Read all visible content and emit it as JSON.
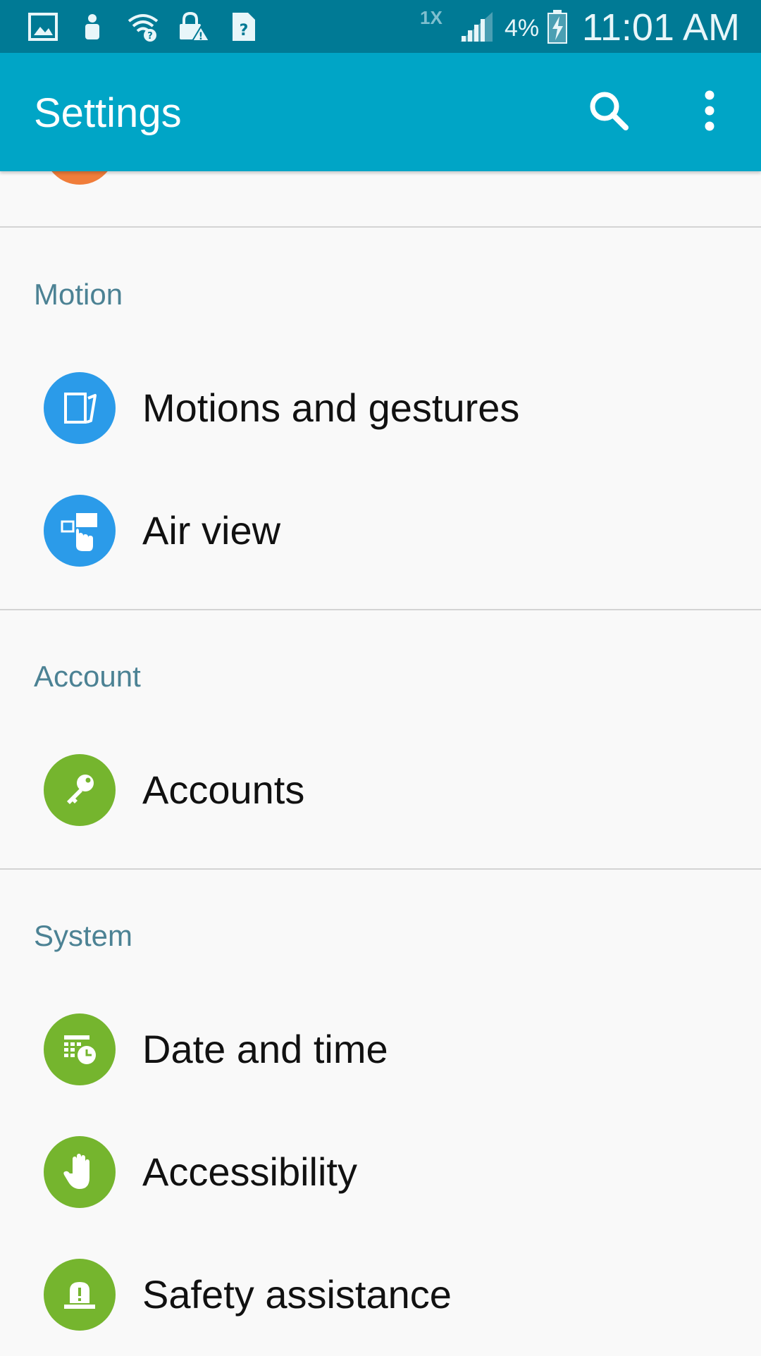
{
  "status_bar": {
    "network_type": "1X",
    "battery_percent": "4%",
    "time": "11:01 AM",
    "background_color": "#007a95",
    "icons": [
      "gallery-icon",
      "person-icon",
      "wifi-question-icon",
      "lock-warning-icon",
      "sim-unknown-icon",
      "signal-icon",
      "battery-charging-icon"
    ]
  },
  "app_bar": {
    "title": "Settings",
    "background_color": "#00a5c6",
    "actions": [
      "search-icon",
      "more-vert-icon"
    ]
  },
  "sections": [
    {
      "header": "Motion",
      "items": [
        {
          "label": "Motions and gestures",
          "icon": "motion-gesture-icon",
          "icon_color": "#2b9be9"
        },
        {
          "label": "Air view",
          "icon": "air-view-icon",
          "icon_color": "#2b9be9"
        }
      ]
    },
    {
      "header": "Account",
      "items": [
        {
          "label": "Accounts",
          "icon": "key-icon",
          "icon_color": "#75b52e"
        }
      ]
    },
    {
      "header": "System",
      "items": [
        {
          "label": "Date and time",
          "icon": "calendar-clock-icon",
          "icon_color": "#75b52e"
        },
        {
          "label": "Accessibility",
          "icon": "hand-icon",
          "icon_color": "#75b52e"
        },
        {
          "label": "Safety assistance",
          "icon": "alert-light-icon",
          "icon_color": "#75b52e"
        }
      ]
    }
  ],
  "colors": {
    "section_header": "#4c8294",
    "item_text": "#111111",
    "background": "#f9f9f9",
    "partial_item_icon": "#f07d3a"
  }
}
